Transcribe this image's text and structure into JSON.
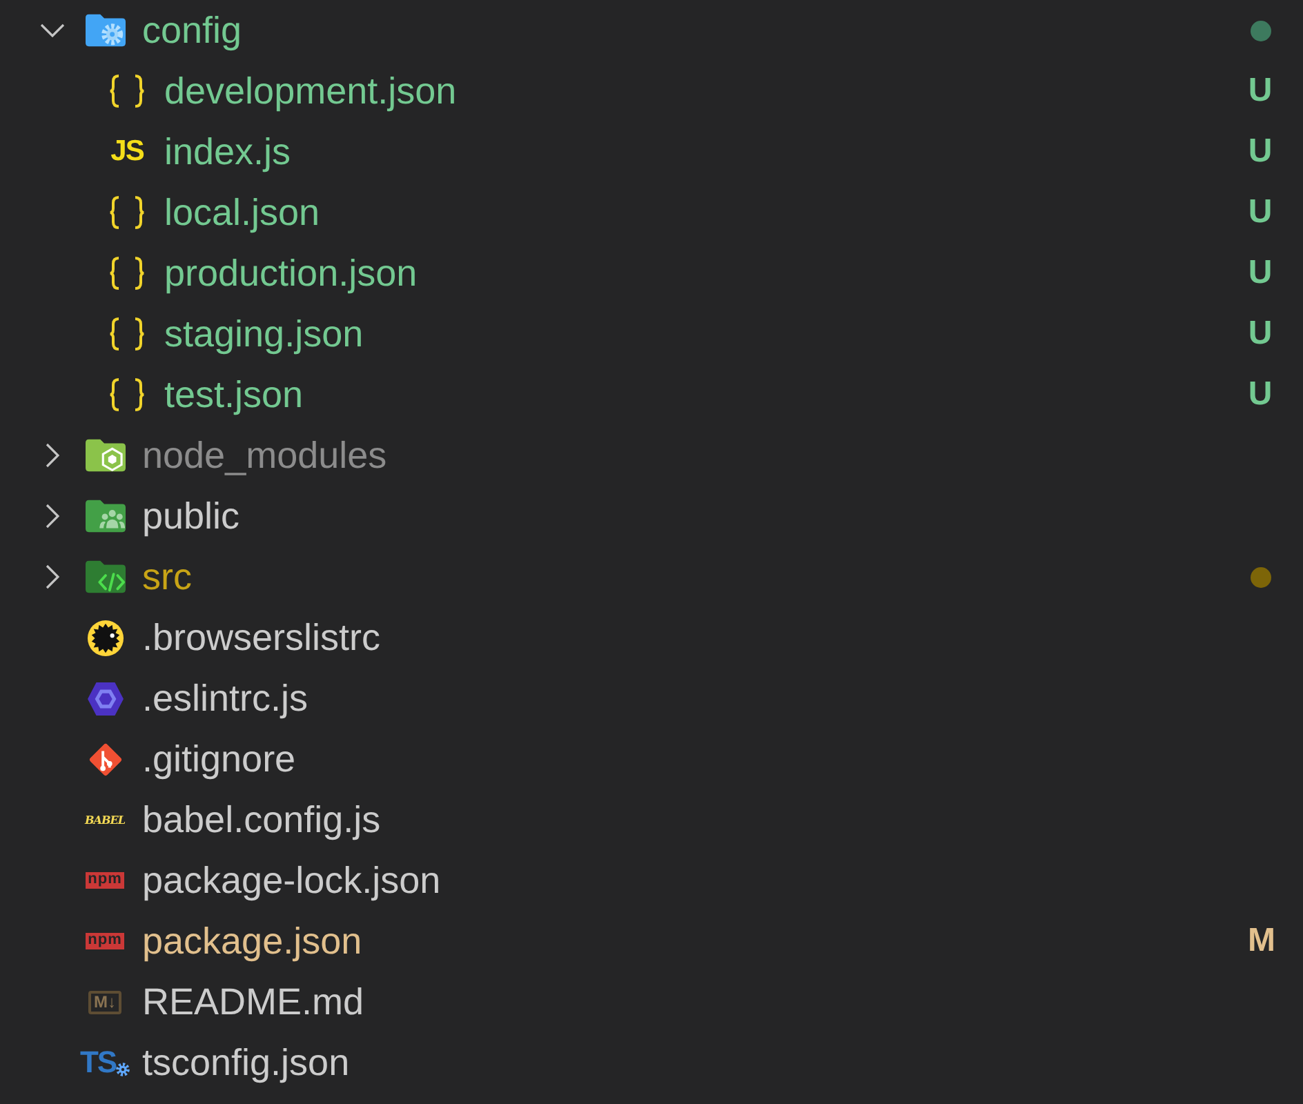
{
  "explorer": {
    "items": [
      {
        "name": "config",
        "kind": "config",
        "expanded": true,
        "color": "#73c991",
        "dot": {
          "color": "#3d7a5e"
        },
        "children": [
          {
            "name": "development.json",
            "kind": "json",
            "color": "#73c991",
            "badge": "U"
          },
          {
            "name": "index.js",
            "kind": "javascript",
            "icon_text": "JS",
            "color": "#73c991",
            "badge": "U"
          },
          {
            "name": "local.json",
            "kind": "json",
            "color": "#73c991",
            "badge": "U"
          },
          {
            "name": "production.json",
            "kind": "json",
            "color": "#73c991",
            "badge": "U"
          },
          {
            "name": "staging.json",
            "kind": "json",
            "color": "#73c991",
            "badge": "U"
          },
          {
            "name": "test.json",
            "kind": "json",
            "color": "#73c991",
            "badge": "U"
          }
        ]
      },
      {
        "name": "node_modules",
        "kind": "modules",
        "expanded": false,
        "color": "#8c8c8c"
      },
      {
        "name": "public",
        "kind": "public",
        "expanded": false,
        "color": "#cccccc"
      },
      {
        "name": "src",
        "kind": "source",
        "expanded": false,
        "color": "#c8a416",
        "dot": {
          "color": "#7d6508"
        }
      },
      {
        "name": ".browserslistrc",
        "kind": "browserslist",
        "color": "#cccccc"
      },
      {
        "name": ".eslintrc.js",
        "kind": "eslint",
        "color": "#cccccc"
      },
      {
        "name": ".gitignore",
        "kind": "git",
        "color": "#cccccc"
      },
      {
        "name": "babel.config.js",
        "kind": "babel",
        "icon_text": "BABEL",
        "color": "#cccccc"
      },
      {
        "name": "package-lock.json",
        "kind": "npm",
        "icon_text": "npm",
        "color": "#cccccc"
      },
      {
        "name": "package.json",
        "kind": "npm",
        "icon_text": "npm",
        "color": "#e2c08d",
        "badge": "M"
      },
      {
        "name": "README.md",
        "kind": "markdown",
        "icon_text": "M↓",
        "color": "#cccccc"
      },
      {
        "name": "tsconfig.json",
        "kind": "typescript",
        "icon_text": "TS",
        "color": "#cccccc"
      }
    ]
  }
}
